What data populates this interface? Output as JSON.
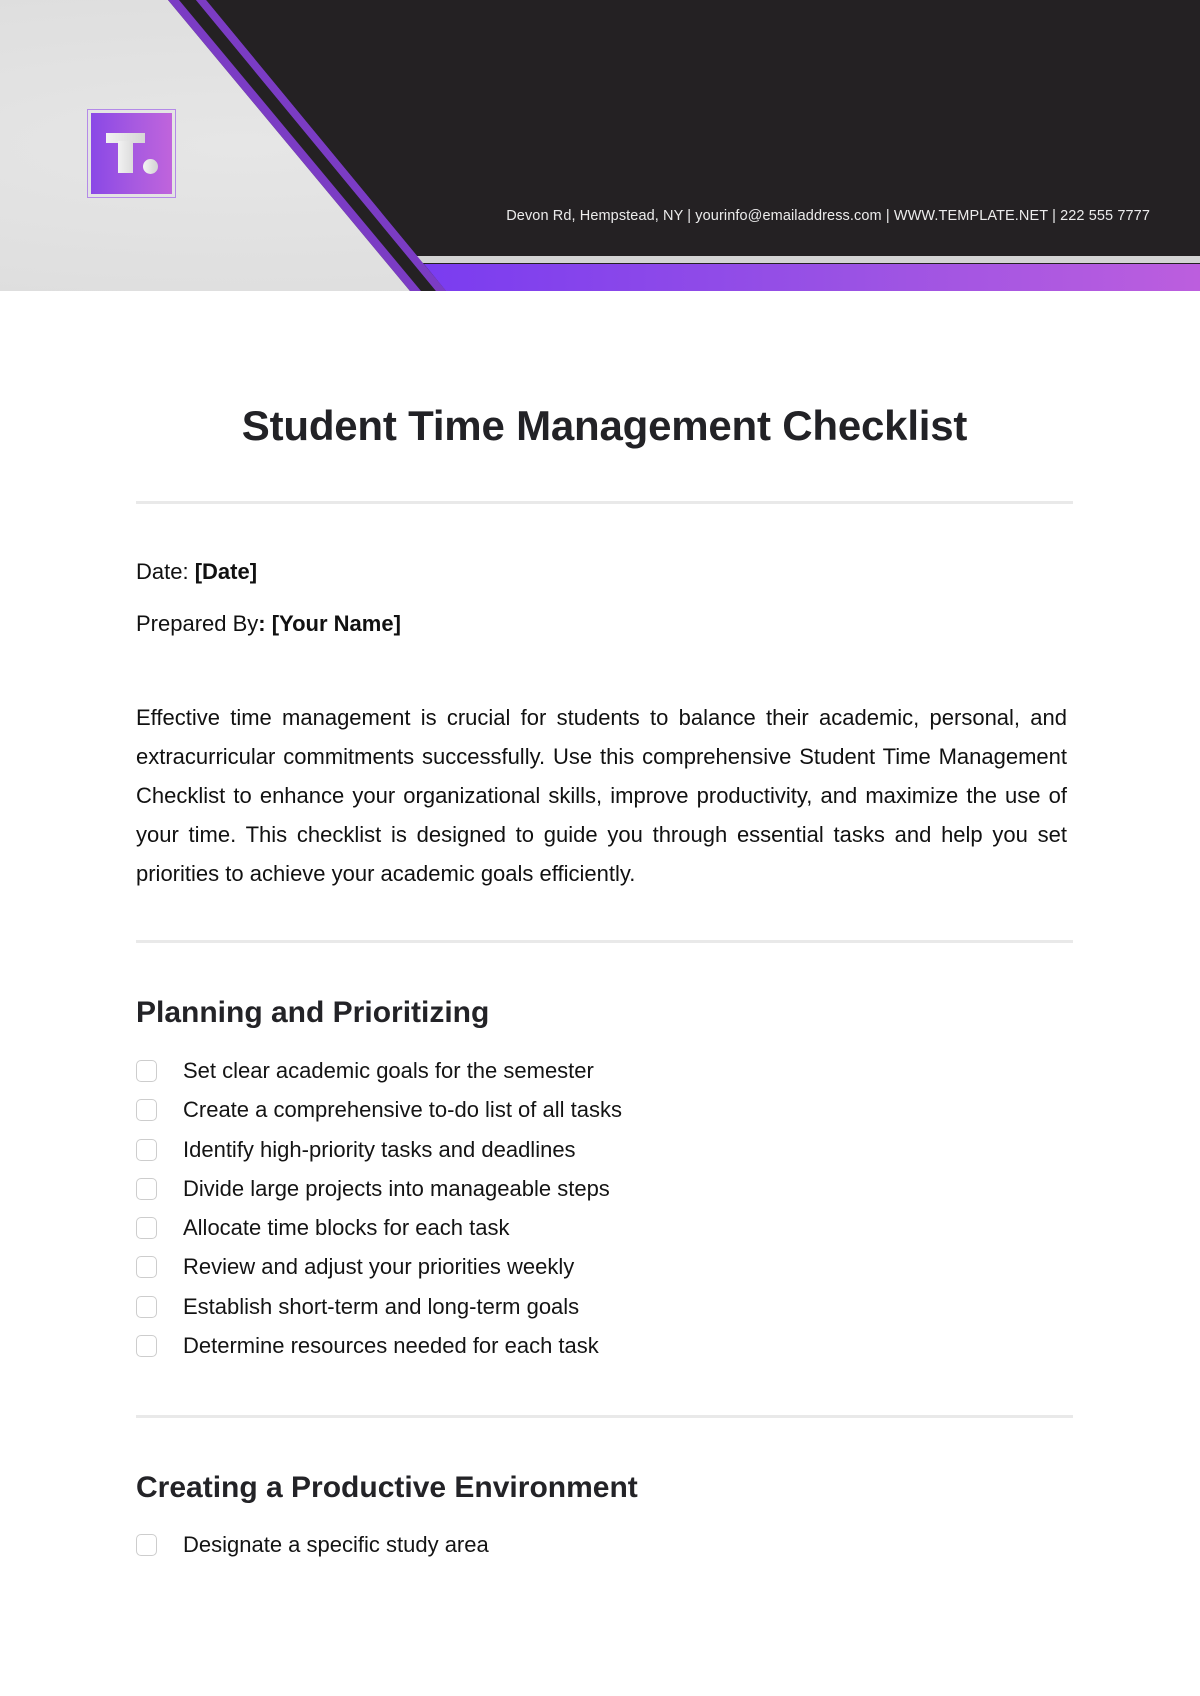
{
  "header": {
    "logo_letter": "T.",
    "contact_line": "Devon Rd, Hempstead, NY | yourinfo@emailaddress.com | WWW.TEMPLATE.NET | 222 555 7777",
    "colors": {
      "dark": "#242123",
      "light_grey": "#e2e2e2",
      "purple": "#7a3cf0",
      "purple_end": "#bc5ede",
      "stripe_purple": "#7b3cc4"
    }
  },
  "document": {
    "title": "Student Time Management Checklist",
    "date_label": "Date: ",
    "date_value": "[Date]",
    "prepared_label": "Prepared By",
    "prepared_value": ": [Your Name]",
    "intro": "Effective time management is crucial for students to balance their academic, personal, and extracurricular commitments successfully. Use this comprehensive Student Time Management Checklist to enhance your organizational skills, improve productivity, and maximize the use of your time. This checklist is designed to guide you through essential tasks and help you set priorities to achieve your academic goals efficiently."
  },
  "sections": [
    {
      "heading": "Planning and Prioritizing",
      "items": [
        {
          "label": "Set clear academic goals for the semester",
          "checked": false
        },
        {
          "label": "Create a comprehensive to-do list of all tasks",
          "checked": false
        },
        {
          "label": "Identify high-priority tasks and deadlines",
          "checked": false
        },
        {
          "label": "Divide large projects into manageable steps",
          "checked": false
        },
        {
          "label": "Allocate time blocks for each task",
          "checked": false
        },
        {
          "label": "Review and adjust your priorities weekly",
          "checked": false
        },
        {
          "label": "Establish short-term and long-term goals",
          "checked": false
        },
        {
          "label": "Determine resources needed for each task",
          "checked": false
        }
      ]
    },
    {
      "heading": "Creating a Productive Environment",
      "items": [
        {
          "label": "Designate a specific study area",
          "checked": false
        }
      ]
    }
  ]
}
